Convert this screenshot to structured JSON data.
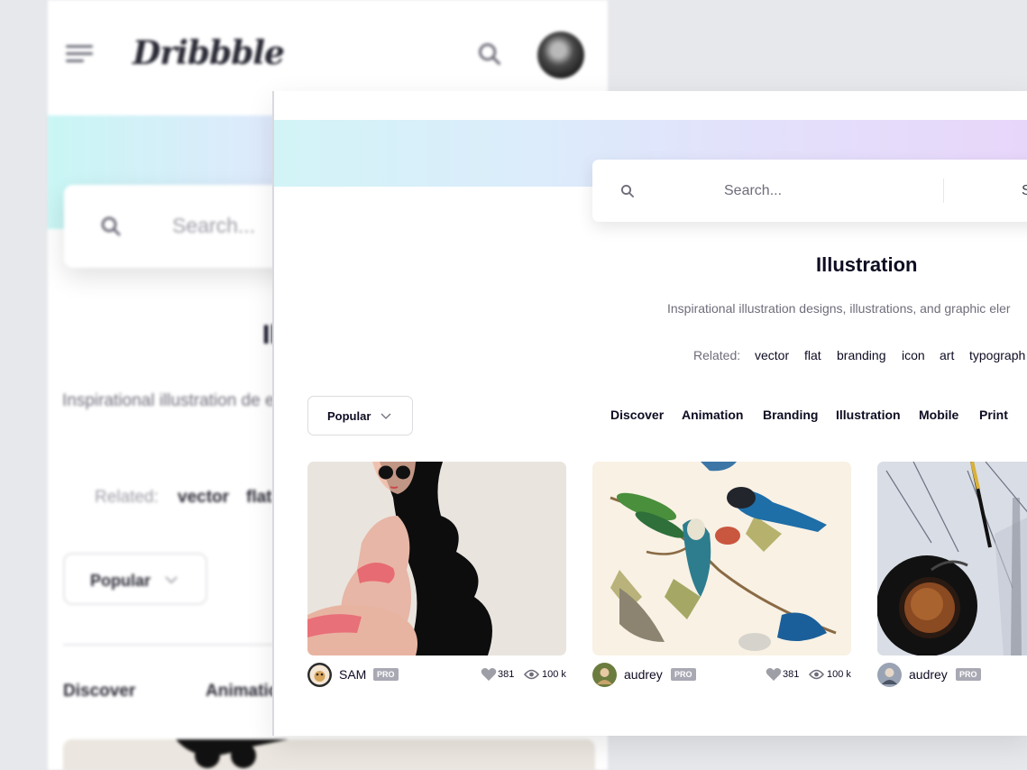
{
  "colors": {
    "accent": "#ea4c89",
    "text_primary": "#0d0c22",
    "text_secondary": "#6e6d7a",
    "pro_badge": "#a9a9b4",
    "gradient_start": "#d2f4f7",
    "gradient_end": "#e8d6fa"
  },
  "mobile": {
    "logo": "Dribbble",
    "search": {
      "placeholder": "Search..."
    },
    "title": "Il",
    "description": "Inspirational illustration de elements",
    "related_label": "Related:",
    "related_tags": [
      "vector",
      "flat"
    ],
    "sort_label": "Popular",
    "categories": [
      "Discover",
      "Animatio"
    ]
  },
  "desktop": {
    "search": {
      "placeholder": "Search...",
      "shots_label": "S"
    },
    "title": "Illustration",
    "description": "Inspirational illustration designs, illustrations, and graphic eler",
    "related_label": "Related:",
    "related_tags": [
      "vector",
      "flat",
      "branding",
      "icon",
      "art",
      "typograph"
    ],
    "sort_label": "Popular",
    "categories": [
      "Discover",
      "Animation",
      "Branding",
      "Illustration",
      "Mobile",
      "Print"
    ],
    "shots": [
      {
        "author": "SAM",
        "badge": "PRO",
        "likes": "381",
        "views": "100 k",
        "image": "woman-illustration",
        "avatar": "sam-avatar"
      },
      {
        "author": "audrey",
        "badge": "PRO",
        "likes": "381",
        "views": "100 k",
        "image": "birds-illustration",
        "avatar": "audrey-avatar"
      },
      {
        "author": "audrey",
        "badge": "PRO",
        "image": "coffee-sketch",
        "avatar": "audrey-avatar-2"
      }
    ]
  }
}
